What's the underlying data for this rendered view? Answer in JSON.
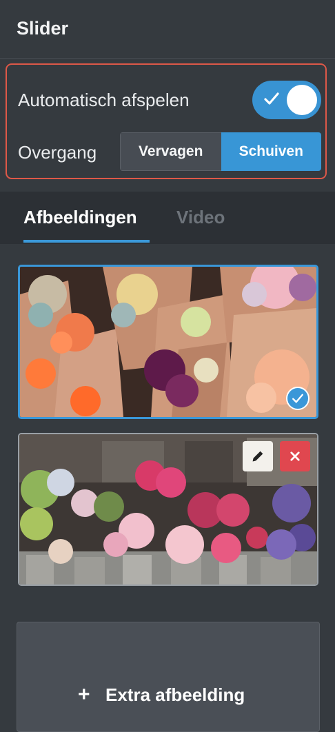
{
  "panel": {
    "title": "Slider"
  },
  "settings": {
    "autoplay_label": "Automatisch afspelen",
    "autoplay_enabled": true,
    "transition_label": "Overgang",
    "transition_options": [
      "Vervagen",
      "Schuiven"
    ],
    "transition_selected": "Schuiven"
  },
  "tabs": [
    {
      "label": "Afbeeldingen",
      "active": true
    },
    {
      "label": "Video",
      "active": false
    }
  ],
  "images": [
    {
      "subject": "flower bouquets in paper wrapping",
      "selected": true
    },
    {
      "subject": "flower shop buckets outside storefront",
      "selected": false
    }
  ],
  "add_image": {
    "icon": "plus-icon",
    "label": "Extra afbeelding"
  },
  "colors": {
    "accent": "#3a97d8",
    "danger": "#e0474f",
    "highlight_border": "#de5848",
    "background": "#353a3f"
  }
}
